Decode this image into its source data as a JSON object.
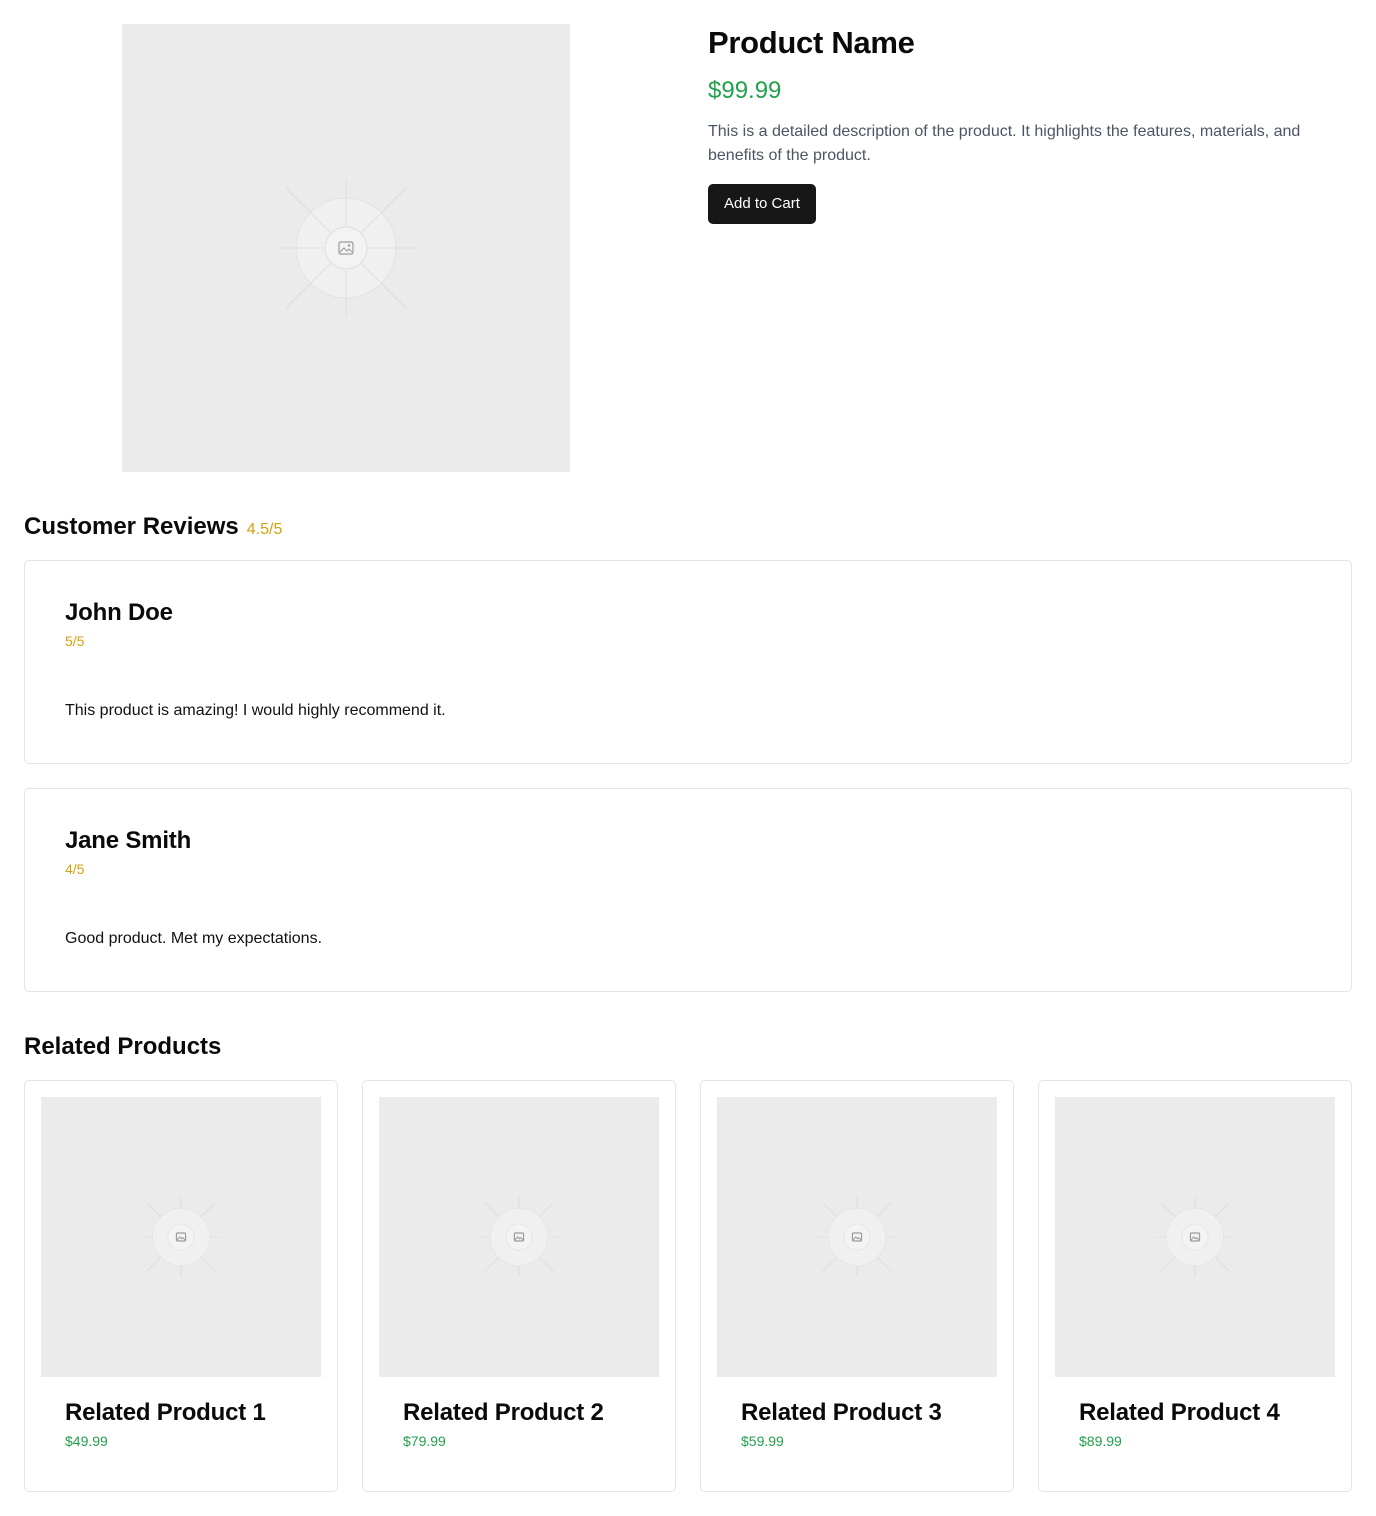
{
  "product": {
    "name": "Product Name",
    "price": "$99.99",
    "description": "This is a detailed description of the product. It highlights the features, materials, and benefits of the product.",
    "add_to_cart_label": "Add to Cart",
    "image_icon": "image-placeholder-icon"
  },
  "reviews": {
    "title": "Customer Reviews",
    "average": "4.5/5",
    "items": [
      {
        "name": "John Doe",
        "rating": "5/5",
        "text": "This product is amazing! I would highly recommend it."
      },
      {
        "name": "Jane Smith",
        "rating": "4/5",
        "text": "Good product. Met my expectations."
      }
    ]
  },
  "related": {
    "title": "Related Products",
    "items": [
      {
        "name": "Related Product 1",
        "price": "$49.99"
      },
      {
        "name": "Related Product 2",
        "price": "$79.99"
      },
      {
        "name": "Related Product 3",
        "price": "$59.99"
      },
      {
        "name": "Related Product 4",
        "price": "$89.99"
      }
    ]
  },
  "colors": {
    "price_green": "#22a04b",
    "rating_gold": "#d4a20c",
    "button_dark": "#171717",
    "placeholder_gray": "#ebebeb"
  }
}
